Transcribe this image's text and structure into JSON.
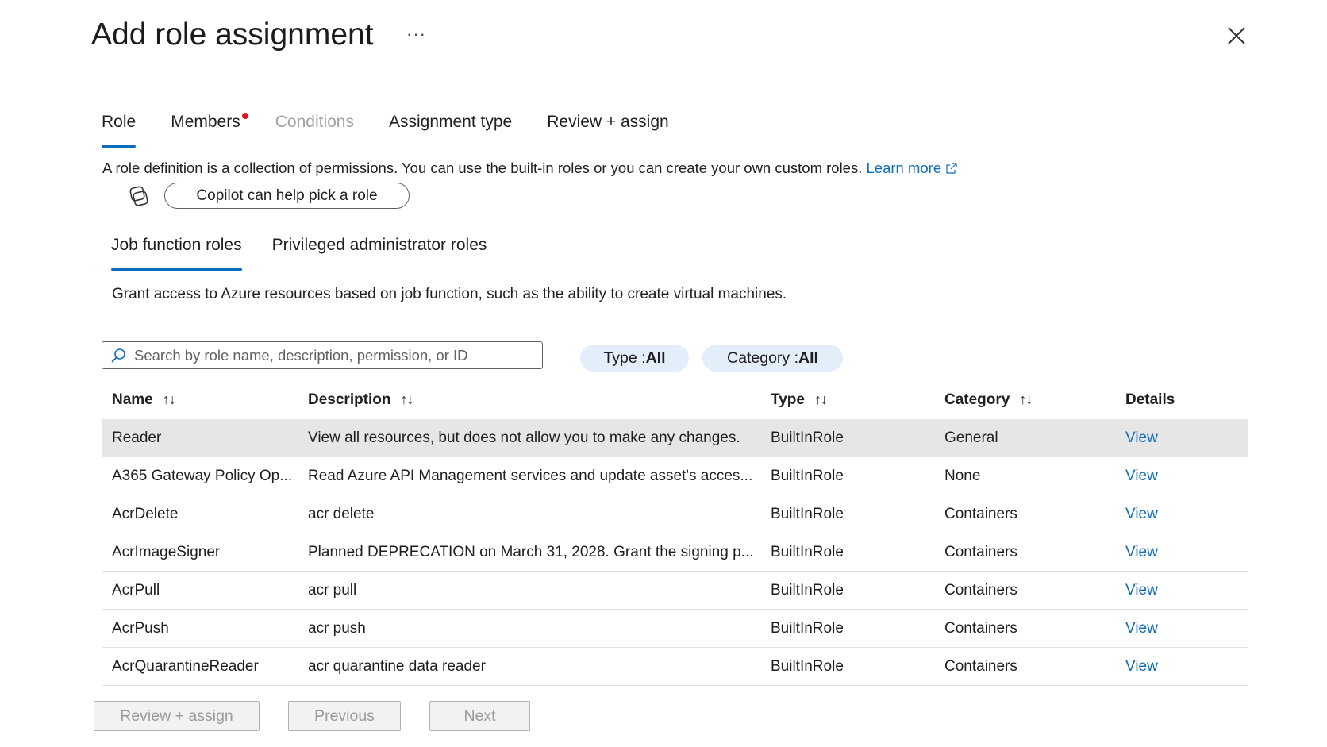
{
  "header": {
    "title": "Add role assignment",
    "more_label": "···"
  },
  "tabs": [
    {
      "label": "Role",
      "active": true,
      "disabled": false
    },
    {
      "label": "Members",
      "active": false,
      "disabled": false,
      "dot": true
    },
    {
      "label": "Conditions",
      "active": false,
      "disabled": true
    },
    {
      "label": "Assignment type",
      "active": false,
      "disabled": false
    },
    {
      "label": "Review + assign",
      "active": false,
      "disabled": false
    }
  ],
  "description": {
    "text": "A role definition is a collection of permissions. You can use the built-in roles or you can create your own custom roles.",
    "learn_more": "Learn more"
  },
  "copilot": {
    "button_label": "Copilot can help pick a role",
    "icon": "copilot-icon"
  },
  "subtabs": [
    {
      "label": "Job function roles",
      "active": true
    },
    {
      "label": "Privileged administrator roles",
      "active": false
    }
  ],
  "subtab_description": "Grant access to Azure resources based on job function, such as the ability to create virtual machines.",
  "search": {
    "placeholder": "Search by role name, description, permission, or ID",
    "value": ""
  },
  "filters": {
    "type": {
      "label": "Type : ",
      "value": "All"
    },
    "category": {
      "label": "Category : ",
      "value": "All"
    }
  },
  "table": {
    "headers": {
      "name": "Name",
      "description": "Description",
      "type": "Type",
      "category": "Category",
      "details": "Details"
    },
    "sort_glyph": "↑↓",
    "rows": [
      {
        "name": "Reader",
        "description": "View all resources, but does not allow you to make any changes.",
        "type": "BuiltInRole",
        "category": "General",
        "details": "View",
        "selected": true
      },
      {
        "name": "A365 Gateway Policy Op...",
        "description": "Read Azure API Management services and update asset's acces...",
        "type": "BuiltInRole",
        "category": "None",
        "details": "View",
        "selected": false
      },
      {
        "name": "AcrDelete",
        "description": "acr delete",
        "type": "BuiltInRole",
        "category": "Containers",
        "details": "View",
        "selected": false
      },
      {
        "name": "AcrImageSigner",
        "description": "Planned DEPRECATION on March 31, 2028. Grant the signing p...",
        "type": "BuiltInRole",
        "category": "Containers",
        "details": "View",
        "selected": false
      },
      {
        "name": "AcrPull",
        "description": "acr pull",
        "type": "BuiltInRole",
        "category": "Containers",
        "details": "View",
        "selected": false
      },
      {
        "name": "AcrPush",
        "description": "acr push",
        "type": "BuiltInRole",
        "category": "Containers",
        "details": "View",
        "selected": false
      },
      {
        "name": "AcrQuarantineReader",
        "description": "acr quarantine data reader",
        "type": "BuiltInRole",
        "category": "Containers",
        "details": "View",
        "selected": false
      }
    ]
  },
  "footer": {
    "review_label": "Review + assign",
    "previous_label": "Previous",
    "next_label": "Next"
  },
  "colors": {
    "accent": "#0f6cbd",
    "selected_row": "#e6e6e6",
    "pill_bg": "#e3eefa",
    "notification_dot": "#e81123"
  }
}
